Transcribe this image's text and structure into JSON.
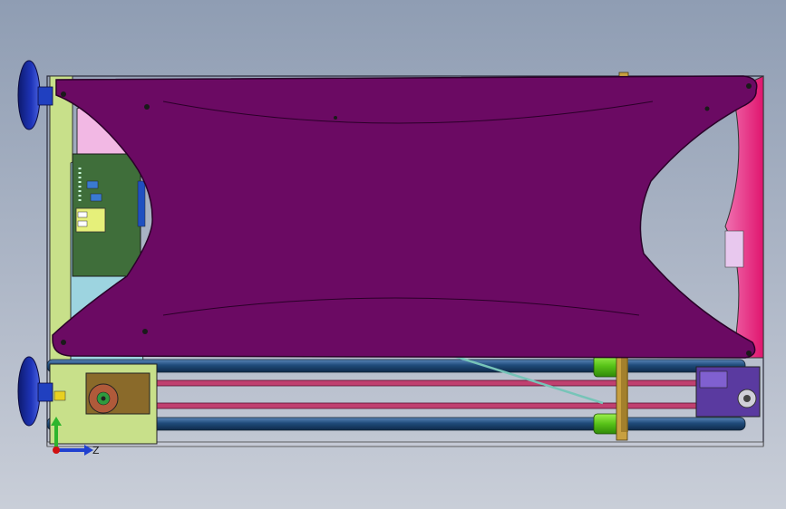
{
  "view": {
    "background_top": "#8f9db3",
    "background_bottom": "#c9ced8"
  },
  "model": {
    "bed_color": "#6b0a63",
    "rod_color": "#1f4b7a",
    "foot_color": "#1a2fa0",
    "bushing_color": "#66cc22",
    "frame_color": "#c8e08a",
    "belt_color": "#b03060",
    "right_panel_color": "#e81e78",
    "left_panel_color": "#9dd4e0",
    "board_color": "#3f6e3a"
  },
  "triad": {
    "z_label": "Z",
    "y_color": "#2db52d",
    "z_color": "#2040d0",
    "origin_color": "#d01010"
  }
}
